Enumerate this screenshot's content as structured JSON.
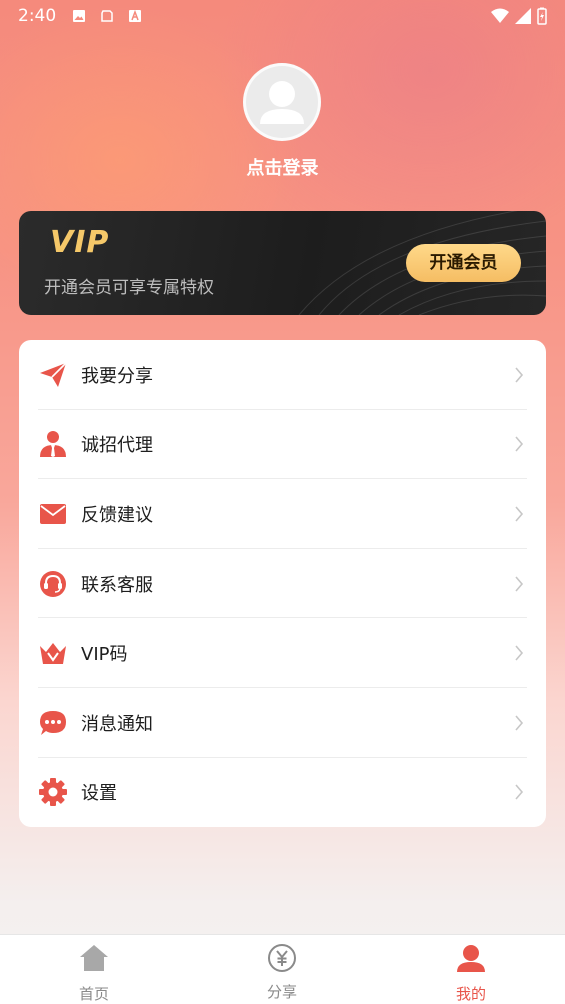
{
  "status_bar": {
    "time": "2:40"
  },
  "profile": {
    "login_label": "点击登录"
  },
  "vip_card": {
    "logo": "VIP",
    "subtitle": "开通会员可享专属特权",
    "button_label": "开通会员"
  },
  "menu": {
    "items": [
      {
        "label": "我要分享",
        "icon": "paper-plane-icon"
      },
      {
        "label": "诚招代理",
        "icon": "agent-person-icon"
      },
      {
        "label": "反馈建议",
        "icon": "mail-icon"
      },
      {
        "label": "联系客服",
        "icon": "headset-icon"
      },
      {
        "label": "VIP码",
        "icon": "crown-icon"
      },
      {
        "label": "消息通知",
        "icon": "chat-bubble-icon"
      },
      {
        "label": "设置",
        "icon": "gear-icon"
      }
    ]
  },
  "tabbar": {
    "tabs": [
      {
        "label": "首页",
        "icon": "home-icon",
        "active": false
      },
      {
        "label": "分享",
        "icon": "yen-coin-icon",
        "active": false
      },
      {
        "label": "我的",
        "icon": "user-icon",
        "active": true
      }
    ]
  },
  "colors": {
    "accent": "#e8554a",
    "vip_gold": "#f5c869",
    "inactive": "#8a8a8a"
  }
}
